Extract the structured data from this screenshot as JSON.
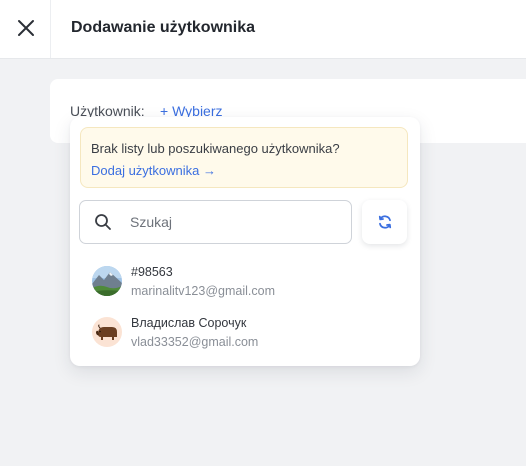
{
  "header": {
    "title": "Dodawanie użytkownika",
    "close_icon": "close-icon"
  },
  "form": {
    "user_label": "Użytkownik:",
    "choose_link": "+ Wybierz"
  },
  "dropdown": {
    "notice": {
      "text": "Brak listy lub poszukiwanego użytkownika?",
      "link": "Dodaj użytkownika →"
    },
    "search": {
      "placeholder": "Szukaj",
      "value": "",
      "icon": "search-icon"
    },
    "refresh_icon": "refresh-icon",
    "users": [
      {
        "name": "#98563",
        "email": "marinalitv123@gmail.com",
        "avatar": "landscape-photo"
      },
      {
        "name": "Владислав Сорочук",
        "email": "vlad33352@gmail.com",
        "avatar": "bison-illustration"
      }
    ]
  },
  "colors": {
    "accent": "#3b6fe0",
    "background": "#f1f2f4",
    "notice_bg": "#fffaeb"
  }
}
